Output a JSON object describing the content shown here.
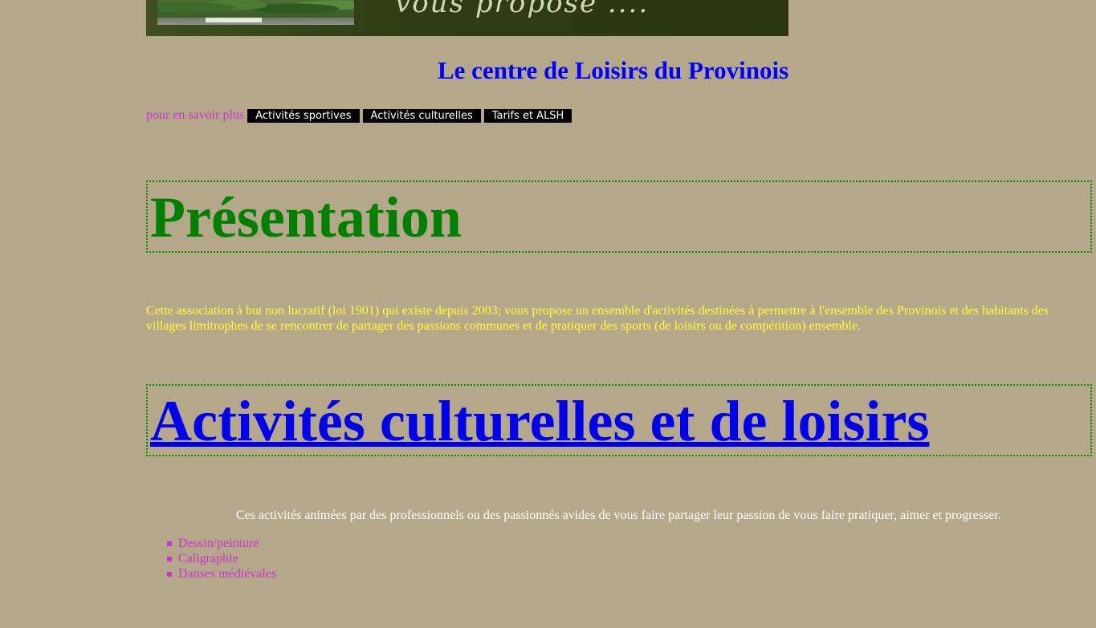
{
  "banner": {
    "text": "vous propose ...."
  },
  "header": {
    "title": "Le centre de Loisirs du Provinois"
  },
  "nav": {
    "intro": "pour en savoir plus",
    "buttons": [
      {
        "label": "Activités sportives"
      },
      {
        "label": "Activités culturelles"
      },
      {
        "label": "Tarifs et ALSH"
      }
    ]
  },
  "presentation": {
    "heading": "Présentation",
    "text": "Cette association à but non lucratif (loi 1901) qui existe depuis 2003; vous propose un ensemble d'activités destinées à permettre à l'ensemble des Provinois et des habitants des villages limitrophes de se rencontrer de partager des passions communes et de pratiquer des sports (de loisirs ou de compétition) ensemble."
  },
  "activities": {
    "heading": "Activités culturelles et de loisirs",
    "text": "Ces activités animées par des professionnels ou des passionnés avides de vous faire partager leur passion de vous faire pratiquer, aimer et progresser.",
    "items": [
      {
        "label": "Dessin/peinture"
      },
      {
        "label": "Caligraphie"
      },
      {
        "label": "Danses médiévales"
      }
    ]
  },
  "colors": {
    "background": "#b5a88a",
    "title": "#0000ff",
    "nav_intro": "#cc33cc",
    "heading_green": "#008000",
    "intro_text": "#ffff33",
    "list_text": "#cc33cc"
  }
}
